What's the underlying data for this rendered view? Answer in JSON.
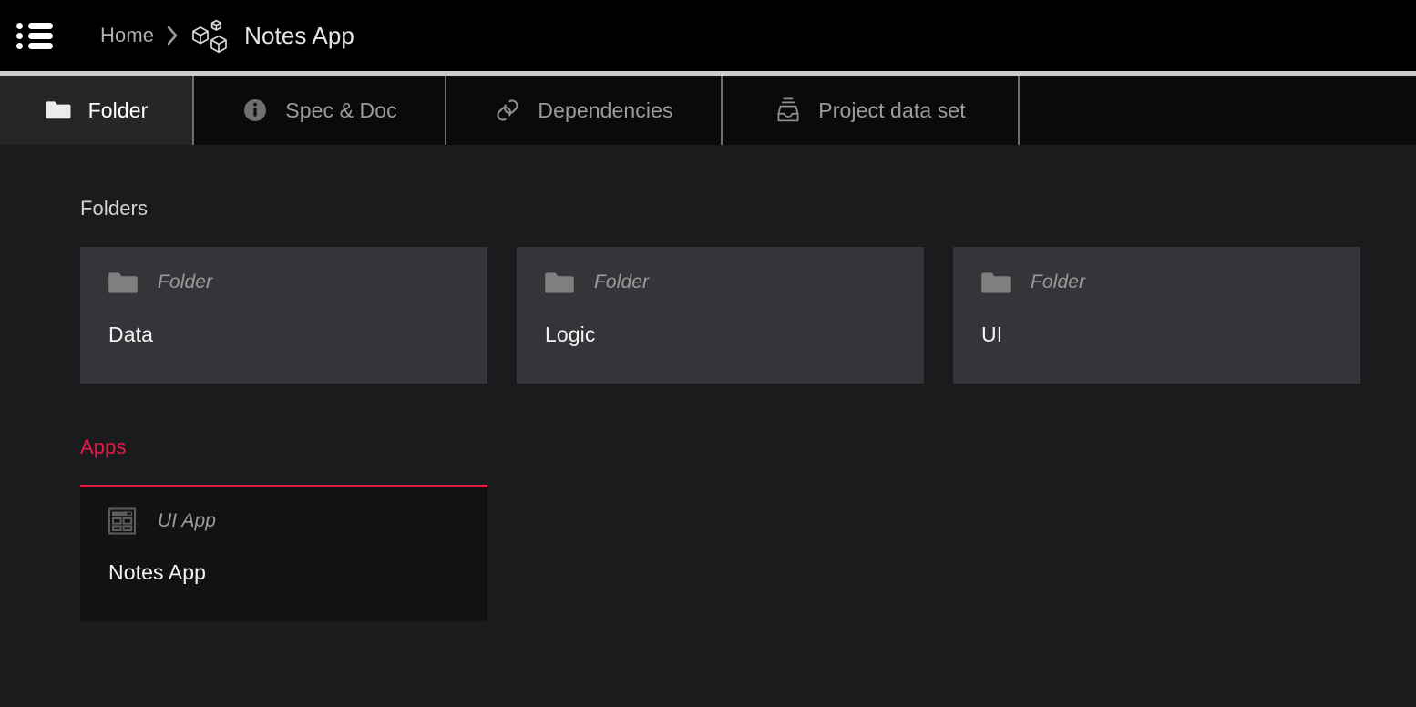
{
  "header": {
    "menu_icon": "list-menu-icon",
    "breadcrumb": {
      "home_label": "Home",
      "separator": "›",
      "project_icon": "cubes-icon",
      "current_label": "Notes App"
    }
  },
  "tabs": [
    {
      "id": "folder",
      "label": "Folder",
      "icon": "folder-icon",
      "active": true
    },
    {
      "id": "spec",
      "label": "Spec & Doc",
      "icon": "info-icon",
      "active": false
    },
    {
      "id": "deps",
      "label": "Dependencies",
      "icon": "link-icon",
      "active": false
    },
    {
      "id": "dataset",
      "label": "Project data set",
      "icon": "inbox-icon",
      "active": false
    }
  ],
  "main": {
    "folders_section": {
      "heading": "Folders",
      "cards": [
        {
          "type": "Folder",
          "name": "Data",
          "icon": "folder-icon"
        },
        {
          "type": "Folder",
          "name": "Logic",
          "icon": "folder-icon"
        },
        {
          "type": "Folder",
          "name": "UI",
          "icon": "folder-icon"
        }
      ]
    },
    "apps_section": {
      "heading": "Apps",
      "cards": [
        {
          "type": "UI App",
          "name": "Notes App",
          "icon": "ui-app-icon"
        }
      ]
    }
  },
  "colors": {
    "page_background": "#1a1b1d",
    "header_background": "#000000",
    "tabbar_background": "#0a0a0a",
    "tabbar_topline": "#c9cdd1",
    "active_tab_background": "#262626",
    "card_background": "#333538",
    "app_card_background": "#111214",
    "accent": "#e31b47",
    "muted_text": "#9a9a9a",
    "primary_text": "#f2f2f2"
  }
}
